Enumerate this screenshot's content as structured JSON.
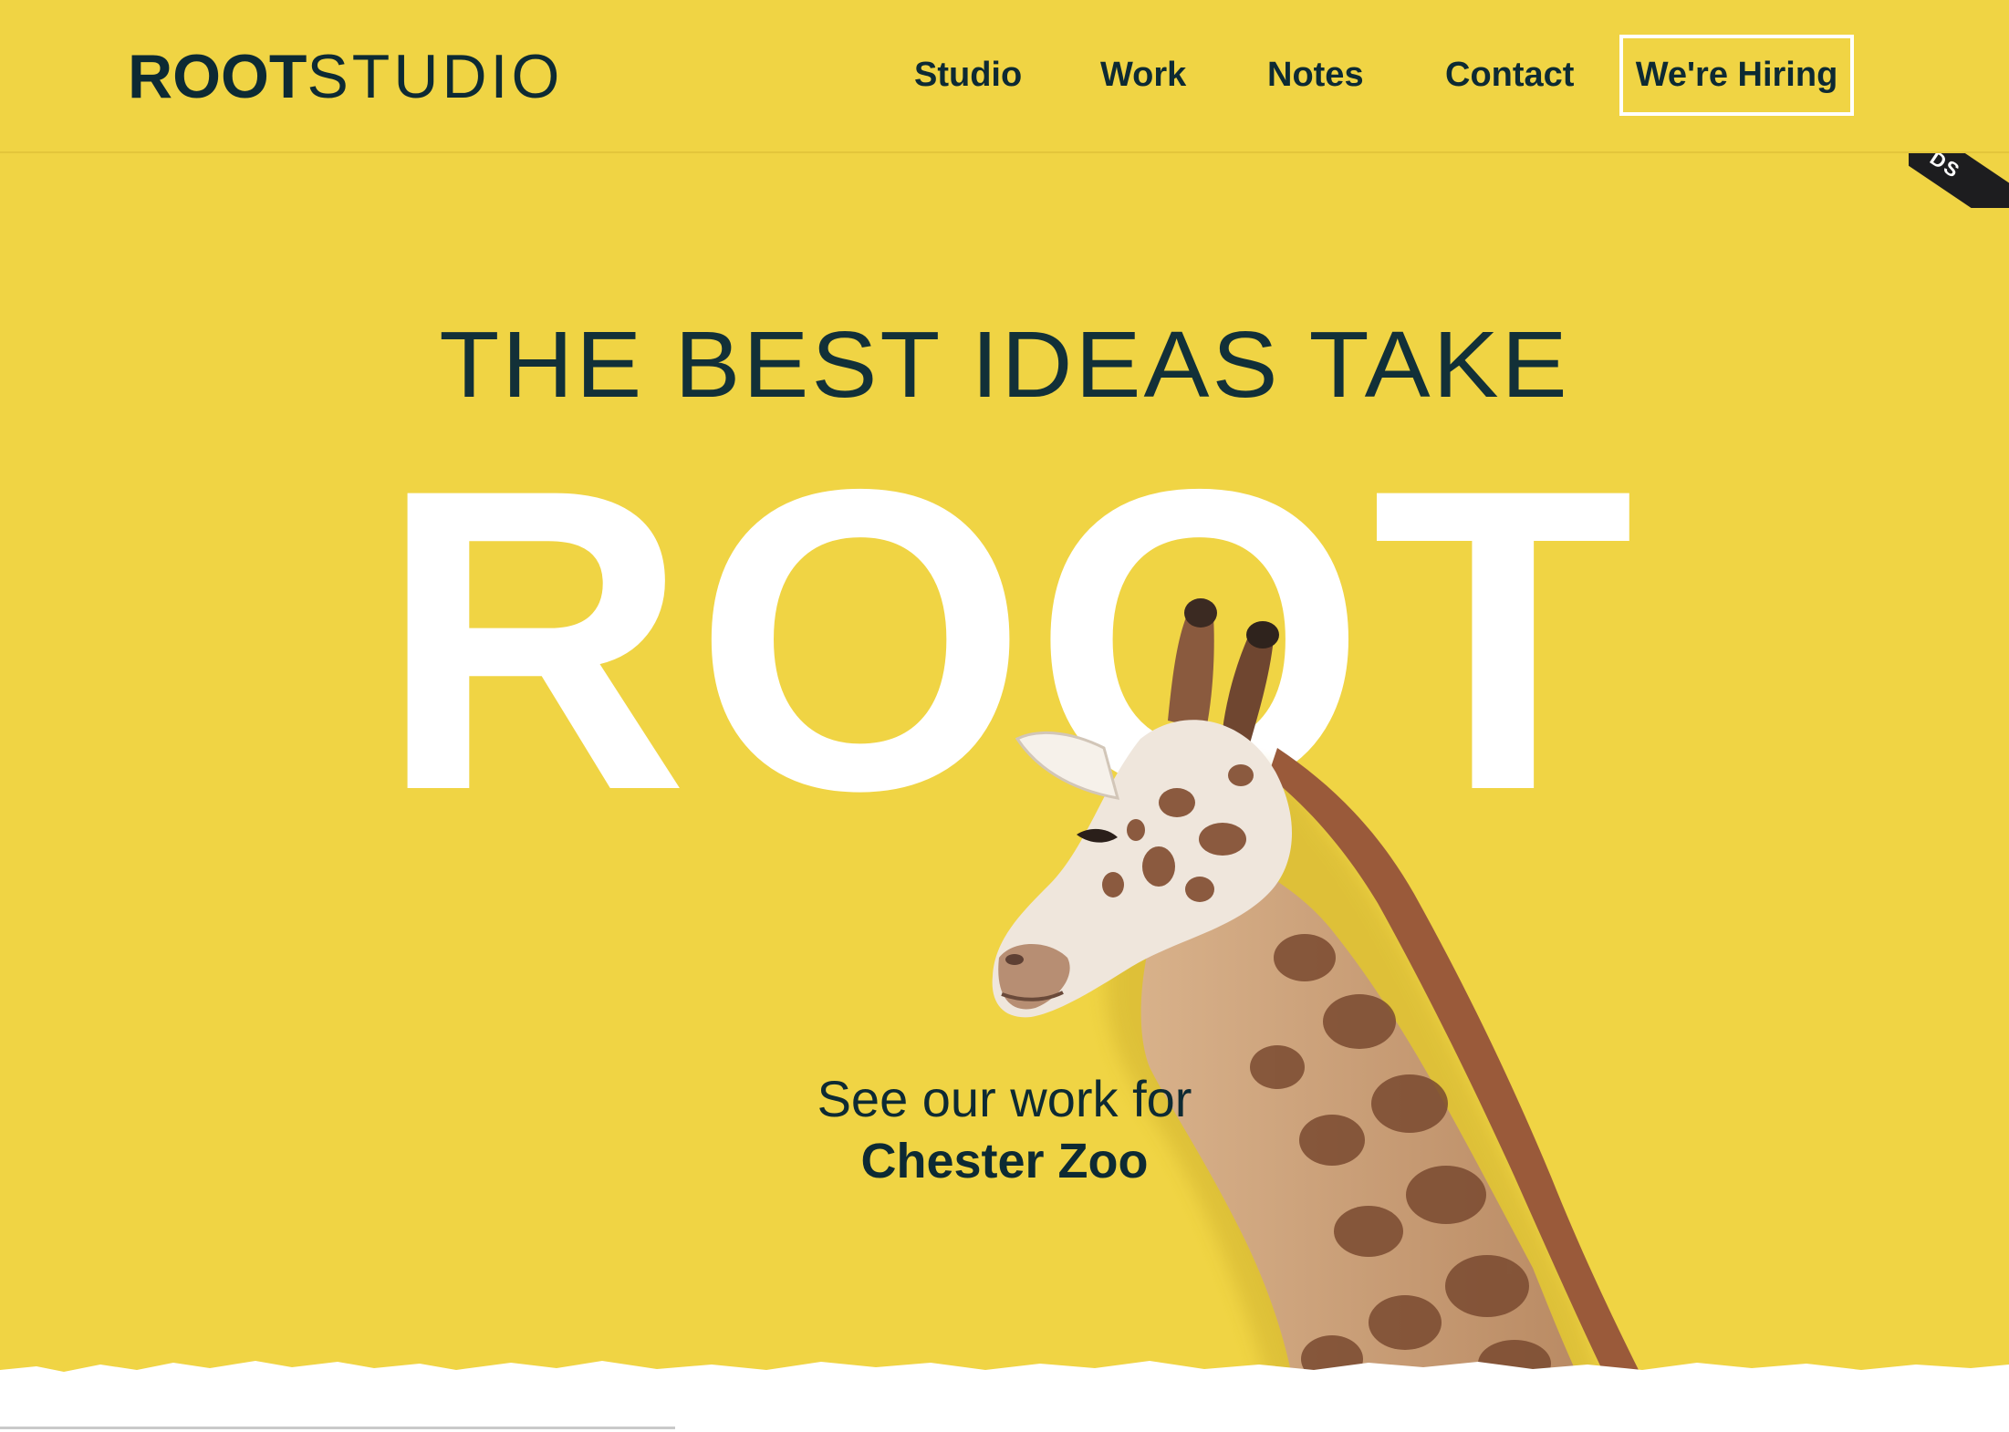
{
  "brand": {
    "logo_bold": "ROOT",
    "logo_light": "STUDIO"
  },
  "nav": {
    "items": [
      {
        "label": "Studio"
      },
      {
        "label": "Work"
      },
      {
        "label": "Notes"
      },
      {
        "label": "Contact"
      }
    ],
    "cta_label": "We're Hiring"
  },
  "hero": {
    "tagline": "THE BEST IDEAS TAKE",
    "big_word": "ROOT",
    "cta_intro": "See our work for",
    "cta_client": "Chester Zoo",
    "illustration": "giraffe"
  },
  "ribbon": {
    "text": "DS"
  },
  "colors": {
    "background": "#f0d444",
    "text_dark": "#0d2a33",
    "big_word": "#ffffff"
  }
}
